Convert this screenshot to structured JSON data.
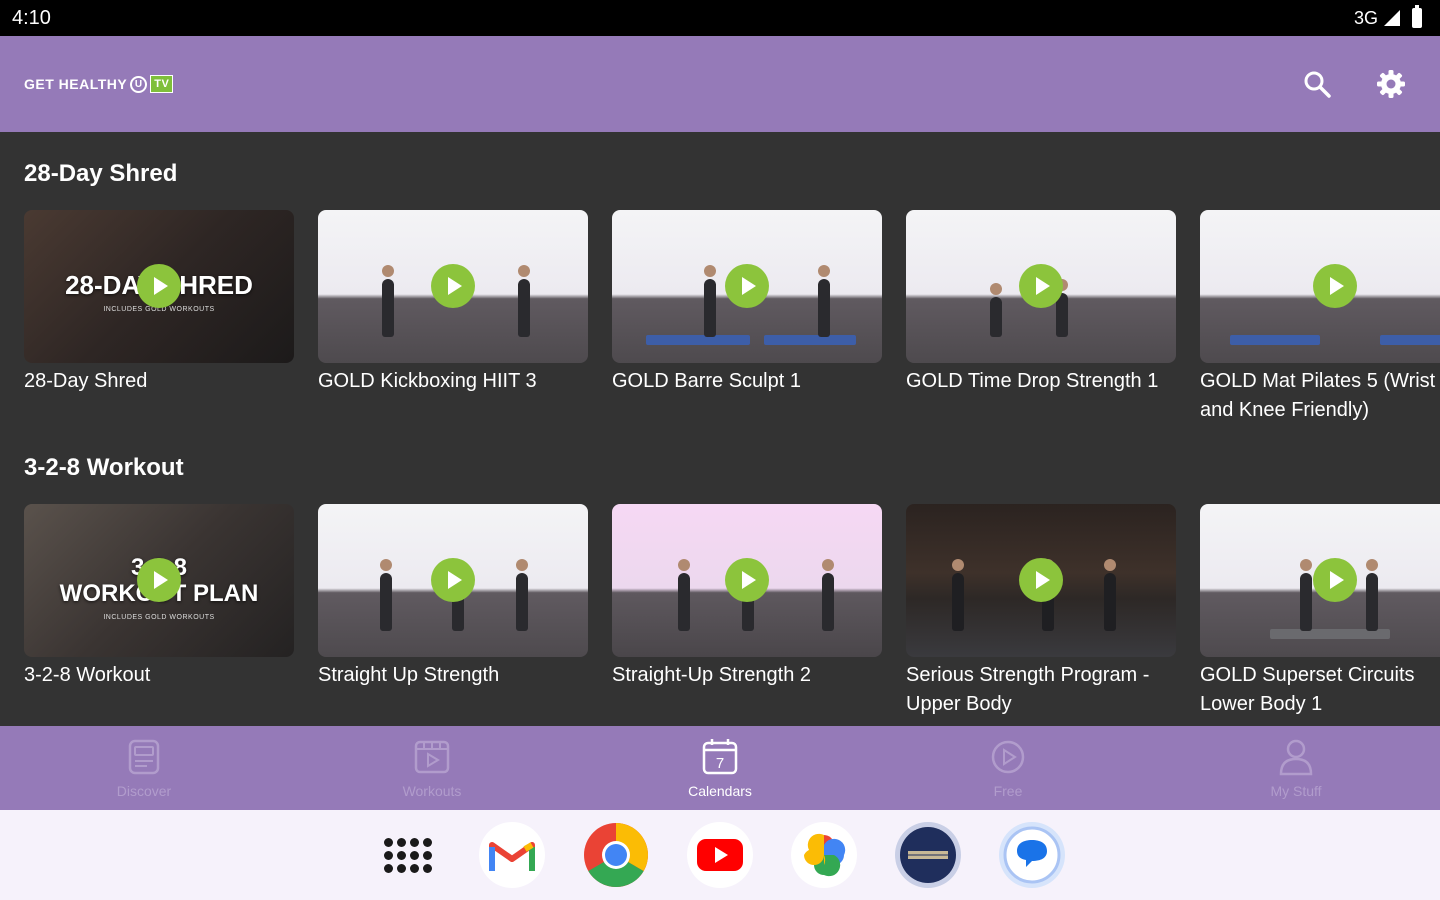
{
  "status_bar": {
    "time": "4:10",
    "network": "3G"
  },
  "app_bar": {
    "logo_text": "GET HEALTHY",
    "logo_u": "U",
    "logo_tv": "TV",
    "search_icon": "search-icon",
    "settings_icon": "gear-icon"
  },
  "sections": [
    {
      "title": "28-Day Shred",
      "cards": [
        {
          "title": "28-Day Shred",
          "promo": "28-DAY SHRED",
          "promo_sub": "INCLUDES GOLD WORKOUTS"
        },
        {
          "title": "GOLD Kickboxing HIIT 3"
        },
        {
          "title": "GOLD Barre Sculpt 1"
        },
        {
          "title": "GOLD Time Drop Strength 1"
        },
        {
          "title": "GOLD Mat Pilates 5 (Wrist and Knee Friendly)"
        }
      ]
    },
    {
      "title": "3-2-8 Workout",
      "cards": [
        {
          "title": "3-2-8 Workout",
          "promo_line1": "3-2-8",
          "promo_line2": "WORKOUT PLAN",
          "promo_sub": "INCLUDES GOLD WORKOUTS"
        },
        {
          "title": "Straight Up Strength"
        },
        {
          "title": "Straight-Up Strength 2"
        },
        {
          "title": "Serious Strength Program - Upper Body"
        },
        {
          "title": "GOLD Superset Circuits Lower Body 1"
        }
      ]
    }
  ],
  "bottom_nav": {
    "active": "Calendars",
    "items": [
      {
        "label": "Discover",
        "icon": "discover-icon"
      },
      {
        "label": "Workouts",
        "icon": "workouts-icon"
      },
      {
        "label": "Calendars",
        "icon": "calendar-icon",
        "day": "7"
      },
      {
        "label": "Free",
        "icon": "play-circle-icon"
      },
      {
        "label": "My Stuff",
        "icon": "person-icon"
      }
    ]
  },
  "taskbar": {
    "apps": [
      "app-drawer-icon",
      "gmail-icon",
      "chrome-icon",
      "youtube-icon",
      "photos-icon",
      "app-icon",
      "messages-icon"
    ]
  },
  "colors": {
    "brand_purple": "#957ab8",
    "accent_green": "#8cc43c",
    "content_bg": "#333333",
    "nav_inactive": "#b19ccc"
  }
}
